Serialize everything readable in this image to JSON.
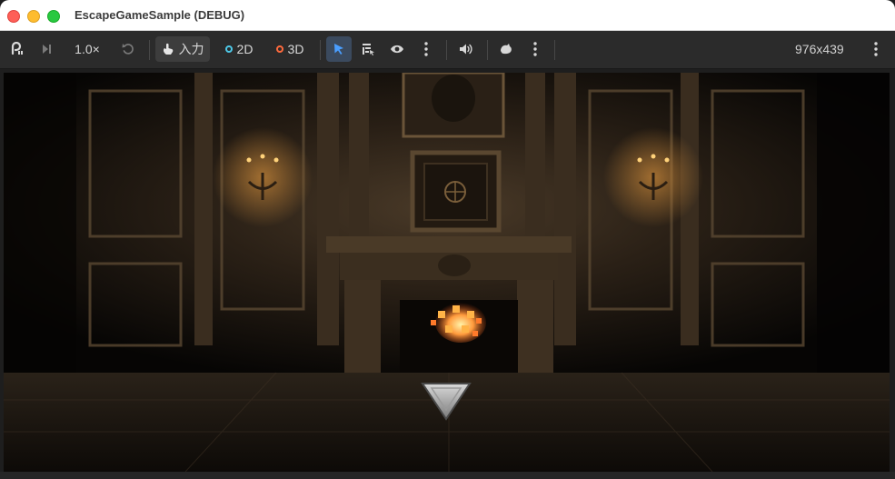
{
  "window": {
    "title": "EscapeGameSample (DEBUG)"
  },
  "toolbar": {
    "speed_label": "1.0×",
    "input_label": "入力",
    "mode_2d_label": "2D",
    "mode_3d_label": "3D",
    "resolution": "976x439",
    "colors": {
      "mode_2d_ring": "#4ec9e8",
      "mode_3d_ring": "#ff6a3d",
      "select_tool": "#4a9eff"
    }
  },
  "viewport": {
    "scene": "dark mansion room with fireplace",
    "nav_arrow_icon": "down-triangle-icon"
  }
}
